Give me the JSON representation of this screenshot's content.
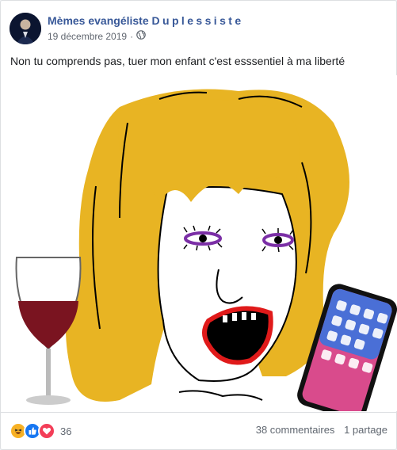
{
  "post": {
    "page_name_main": "Mèmes evangéliste",
    "page_name_spaced": "Duplessiste",
    "date": "19 décembre 2019",
    "separator": "·",
    "privacy_icon": "globe-icon",
    "text": "Non tu comprends pas, tuer mon enfant c'est esssentiel à ma liberté"
  },
  "image": {
    "subject": "meme-drawing",
    "colors": {
      "hair": "#e8b423",
      "wine": "#7a1420",
      "mouth_outline": "#e01a1a",
      "eyes": "#7b2fa6"
    }
  },
  "footer": {
    "reaction_icons": [
      "haha-icon",
      "like-icon",
      "love-icon"
    ],
    "reaction_count": "36",
    "comments": "38 commentaires",
    "shares": "1 partage"
  },
  "colors": {
    "link": "#385898",
    "like": "#1877f2",
    "love": "#f33e58",
    "haha": "#f7b125"
  }
}
